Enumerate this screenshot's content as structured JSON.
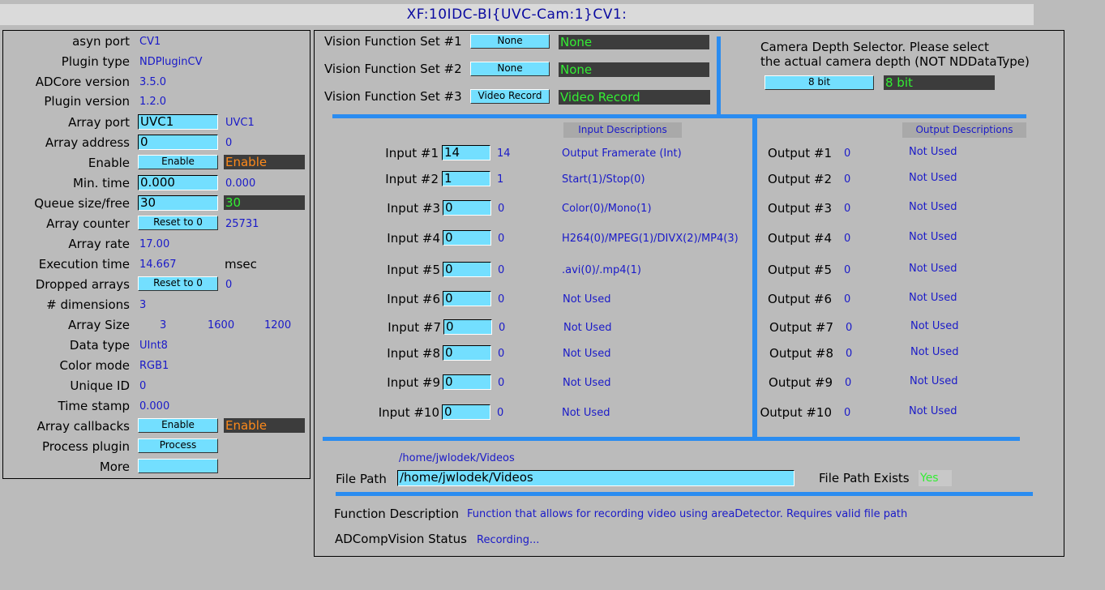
{
  "title": "XF:10IDC-BI{UVC-Cam:1}CV1:",
  "left_panel": {
    "asyn_port": {
      "label": "asyn port",
      "value": "CV1"
    },
    "plugin_type": {
      "label": "Plugin type",
      "value": "NDPluginCV"
    },
    "adcore_version": {
      "label": "ADCore version",
      "value": "3.5.0"
    },
    "plugin_version": {
      "label": "Plugin version",
      "value": "1.2.0"
    },
    "array_port": {
      "label": "Array port",
      "input": "UVC1",
      "readback": "UVC1"
    },
    "array_address": {
      "label": "Array address",
      "input": "0",
      "readback": "0"
    },
    "enable": {
      "label": "Enable",
      "button": "Enable",
      "status": "Enable"
    },
    "min_time": {
      "label": "Min. time",
      "input": "0.000",
      "readback": "0.000"
    },
    "queue": {
      "label": "Queue size/free",
      "input": "30",
      "status": "30"
    },
    "array_counter": {
      "label": "Array counter",
      "button": "Reset to 0",
      "readback": "25731"
    },
    "array_rate": {
      "label": "Array rate",
      "value": "17.00"
    },
    "execution_time": {
      "label": "Execution time",
      "value": "14.667",
      "unit": "msec"
    },
    "dropped_arrays": {
      "label": "Dropped arrays",
      "button": "Reset to 0",
      "readback": "0"
    },
    "dimensions": {
      "label": "# dimensions",
      "value": "3"
    },
    "array_size": {
      "label": "Array Size",
      "x": "3",
      "y": "1600",
      "z": "1200"
    },
    "data_type": {
      "label": "Data type",
      "value": "UInt8"
    },
    "color_mode": {
      "label": "Color mode",
      "value": "RGB1"
    },
    "unique_id": {
      "label": "Unique ID",
      "value": "0"
    },
    "time_stamp": {
      "label": "Time stamp",
      "value": "0.000"
    },
    "array_callbacks": {
      "label": "Array callbacks",
      "button": "Enable",
      "status": "Enable"
    },
    "process_plugin": {
      "label": "Process plugin",
      "button": "Process"
    },
    "more": {
      "label": "More",
      "button": ""
    }
  },
  "function_sets": [
    {
      "label": "Vision Function Set #1",
      "button": "None",
      "status": "None"
    },
    {
      "label": "Vision Function Set #2",
      "button": "None",
      "status": "None"
    },
    {
      "label": "Vision Function Set #3",
      "button": "Video Record",
      "status": "Video Record"
    }
  ],
  "camera_depth": {
    "text_line1": "Camera Depth Selector. Please select",
    "text_line2": "the actual camera depth (NOT NDDataType)",
    "button": "8 bit",
    "status": "8 bit"
  },
  "inputs_header": "Input Descriptions",
  "outputs_header": "Output Descriptions",
  "inputs": [
    {
      "label": "Input #1",
      "value": "14",
      "readback": "14",
      "desc": "Output Framerate (Int)"
    },
    {
      "label": "Input #2",
      "value": "1",
      "readback": "1",
      "desc": "Start(1)/Stop(0)"
    },
    {
      "label": "Input #3",
      "value": "0",
      "readback": "0",
      "desc": "Color(0)/Mono(1)"
    },
    {
      "label": "Input #4",
      "value": "0",
      "readback": "0",
      "desc": "H264(0)/MPEG(1)/DIVX(2)/MP4(3)"
    },
    {
      "label": "Input #5",
      "value": "0",
      "readback": "0",
      "desc": ".avi(0)/.mp4(1)"
    },
    {
      "label": "Input #6",
      "value": "0",
      "readback": "0",
      "desc": "Not Used"
    },
    {
      "label": "Input #7",
      "value": "0",
      "readback": "0",
      "desc": "Not Used"
    },
    {
      "label": "Input #8",
      "value": "0",
      "readback": "0",
      "desc": "Not Used"
    },
    {
      "label": "Input #9",
      "value": "0",
      "readback": "0",
      "desc": "Not Used"
    },
    {
      "label": "Input #10",
      "value": "0",
      "readback": "0",
      "desc": "Not Used"
    }
  ],
  "outputs": [
    {
      "label": "Output #1",
      "value": "0",
      "desc": "Not Used"
    },
    {
      "label": "Output #2",
      "value": "0",
      "desc": "Not Used"
    },
    {
      "label": "Output #3",
      "value": "0",
      "desc": "Not Used"
    },
    {
      "label": "Output #4",
      "value": "0",
      "desc": "Not Used"
    },
    {
      "label": "Output #5",
      "value": "0",
      "desc": "Not Used"
    },
    {
      "label": "Output #6",
      "value": "0",
      "desc": "Not Used"
    },
    {
      "label": "Output #7",
      "value": "0",
      "desc": "Not Used"
    },
    {
      "label": "Output #8",
      "value": "0",
      "desc": "Not Used"
    },
    {
      "label": "Output #9",
      "value": "0",
      "desc": "Not Used"
    },
    {
      "label": "Output #10",
      "value": "0",
      "desc": "Not Used"
    }
  ],
  "file_path": {
    "readback": "/home/jwlodek/Videos",
    "label": "File Path",
    "input": "/home/jwlodek/Videos",
    "exists_label": "File Path Exists",
    "exists_value": "Yes"
  },
  "function_description": {
    "label": "Function Description",
    "value": "Function that allows for recording video using areaDetector. Requires valid file path"
  },
  "status": {
    "label": "ADCompVision Status",
    "value": "Recording..."
  },
  "colors": {
    "background": "#bbbbbb",
    "entry": "#73dfff",
    "readback": "#1a1ac8",
    "alarm_orange": "#ff8a1a",
    "ok_green": "#33ee33",
    "divider": "#2a8cf0"
  }
}
